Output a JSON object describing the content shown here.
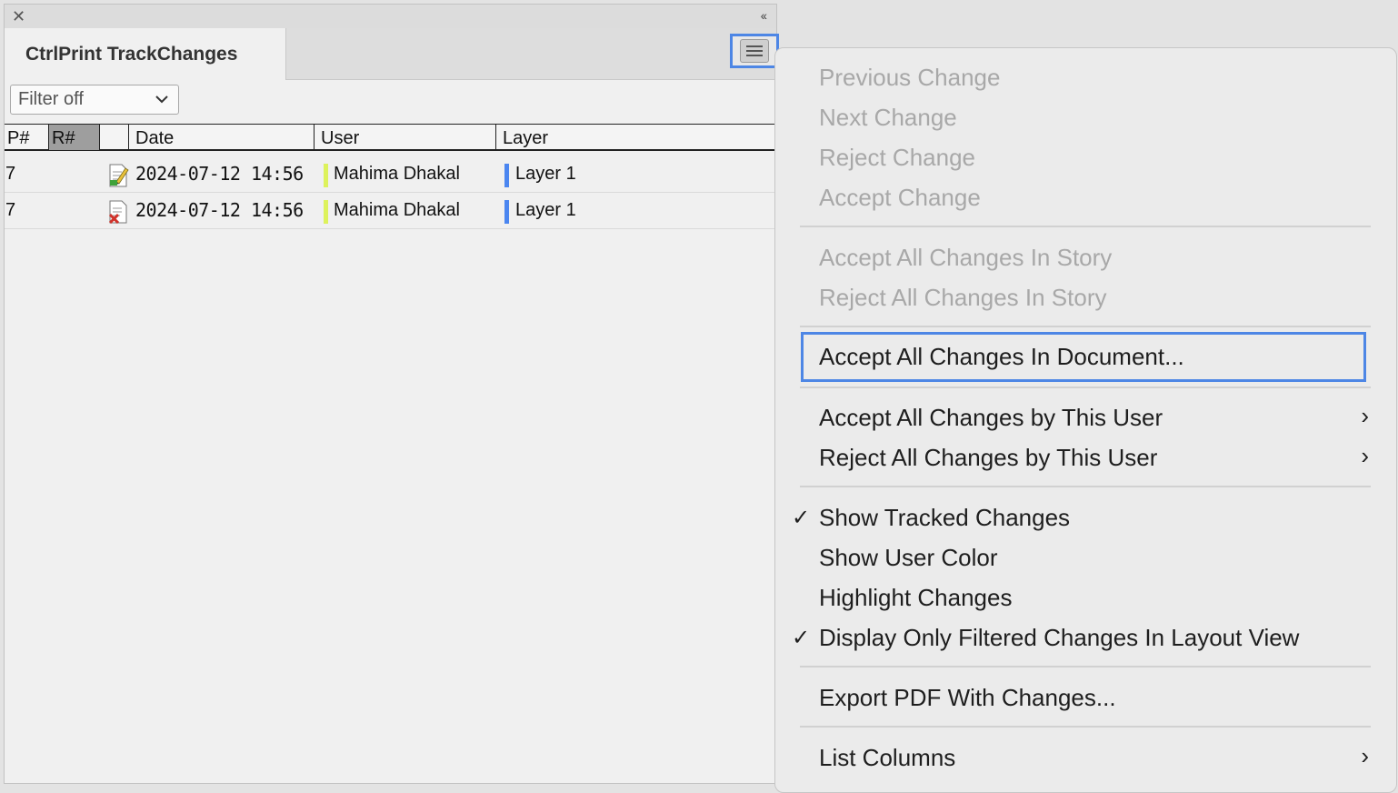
{
  "panel": {
    "close_glyph": "✕",
    "collapse_glyph": "‹‹",
    "tab_title": "CtrlPrint TrackChanges",
    "filter_value": "Filter off"
  },
  "table": {
    "headers": {
      "p": "P#",
      "r": "R#",
      "icon": "",
      "date": "Date",
      "user": "User",
      "layer": "Layer"
    },
    "rows": [
      {
        "p": "7",
        "icon": "edit-document-icon",
        "date": "2024-07-12 14:56",
        "user": "Mahima Dhakal",
        "layer": "Layer 1"
      },
      {
        "p": "7",
        "icon": "delete-document-icon",
        "date": "2024-07-12 14:56",
        "user": "Mahima Dhakal",
        "layer": "Layer 1"
      }
    ],
    "user_color": "#ddf25c",
    "layer_color": "#4b86f0"
  },
  "menu": {
    "previous_change": "Previous Change",
    "next_change": "Next Change",
    "reject_change": "Reject Change",
    "accept_change": "Accept Change",
    "accept_all_story": "Accept All Changes In Story",
    "reject_all_story": "Reject All Changes In Story",
    "accept_all_document": "Accept All Changes In Document...",
    "accept_all_user": "Accept All Changes by This User",
    "reject_all_user": "Reject All Changes by This User",
    "show_tracked": "Show Tracked Changes",
    "show_user_color": "Show User Color",
    "highlight_changes": "Highlight Changes",
    "display_filtered": "Display Only Filtered Changes In Layout View",
    "export_pdf": "Export PDF With Changes...",
    "list_columns": "List Columns",
    "check_glyph": "✓",
    "arrow_glyph": "›"
  },
  "accent_color": "#4d86e5"
}
